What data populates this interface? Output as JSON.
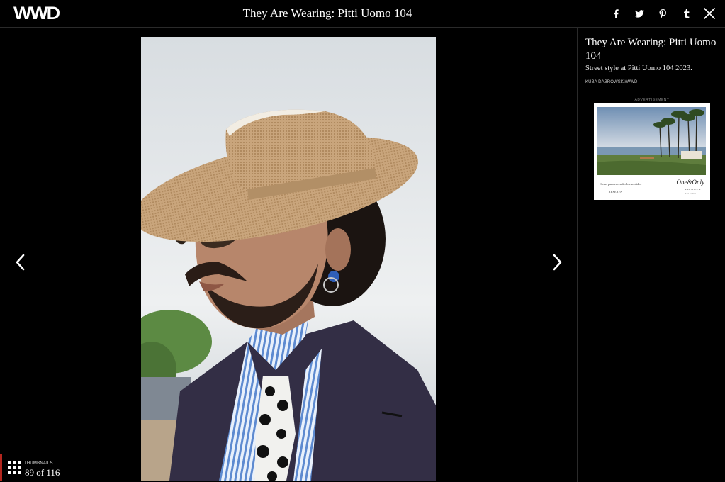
{
  "header": {
    "logo": "WWD",
    "title": "They Are Wearing: Pitti Uomo 104",
    "social_icons": [
      "facebook-icon",
      "twitter-icon",
      "pinterest-icon",
      "tumblr-icon"
    ],
    "close_icon": "close-icon"
  },
  "gallery": {
    "photo_icon": "street-style-photo",
    "prev_icon": "chevron-left-icon",
    "next_icon": "chevron-right-icon",
    "thumbnails_label": "THUMBNAILS",
    "counter": "89 of 116"
  },
  "sidebar": {
    "title": "They Are Wearing: Pitti Uomo 104",
    "caption": "Street style at Pitti Uomo 104 2023.",
    "credit": "KUBA DABROWSKI/WWD",
    "ad_label": "ADVERTISEMENT",
    "ad": {
      "tagline": "Cosas para encender los sentidos",
      "button": "RESERVA",
      "brand": "One&Only",
      "sub": "PALMILLA",
      "sub2": "Los Cabos"
    }
  },
  "colors": {
    "background": "#000000",
    "accent": "#b3261e",
    "text": "#ffffff"
  }
}
